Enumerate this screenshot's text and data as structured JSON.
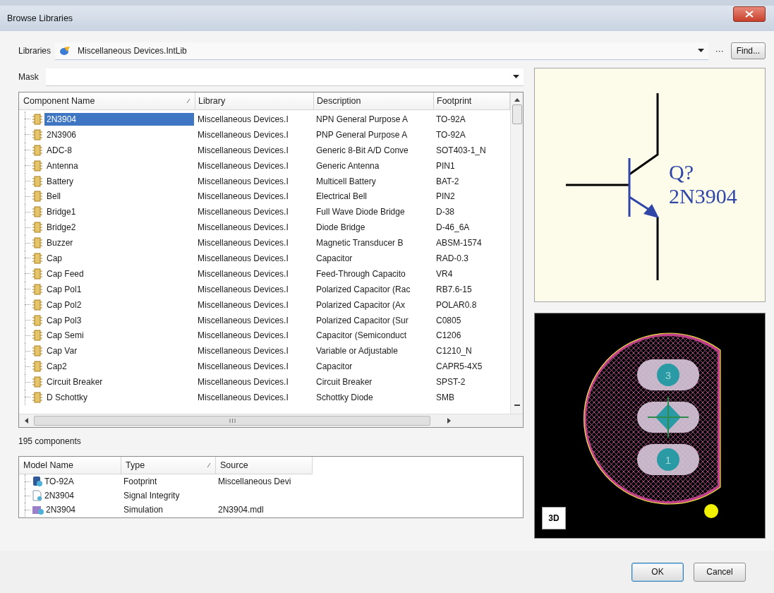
{
  "window": {
    "title": "Browse Libraries"
  },
  "libraries": {
    "label": "Libraries",
    "value": "Miscellaneous Devices.IntLib",
    "more_button": "···",
    "find_button": "Find..."
  },
  "mask": {
    "label": "Mask"
  },
  "components_table": {
    "columns": [
      {
        "label": "Component Name",
        "sorted": true
      },
      {
        "label": "Library",
        "sorted": false
      },
      {
        "label": "Description",
        "sorted": false
      },
      {
        "label": "Footprint",
        "sorted": false
      }
    ],
    "rows": [
      {
        "name": "2N3904",
        "library": "Miscellaneous Devices.I",
        "description": "NPN General Purpose A",
        "footprint": "TO-92A",
        "selected": true
      },
      {
        "name": "2N3906",
        "library": "Miscellaneous Devices.I",
        "description": "PNP General Purpose A",
        "footprint": "TO-92A",
        "selected": false
      },
      {
        "name": "ADC-8",
        "library": "Miscellaneous Devices.I",
        "description": "Generic 8-Bit A/D Conve",
        "footprint": "SOT403-1_N",
        "selected": false
      },
      {
        "name": "Antenna",
        "library": "Miscellaneous Devices.I",
        "description": "Generic Antenna",
        "footprint": "PIN1",
        "selected": false
      },
      {
        "name": "Battery",
        "library": "Miscellaneous Devices.I",
        "description": "Multicell Battery",
        "footprint": "BAT-2",
        "selected": false
      },
      {
        "name": "Bell",
        "library": "Miscellaneous Devices.I",
        "description": "Electrical Bell",
        "footprint": "PIN2",
        "selected": false
      },
      {
        "name": "Bridge1",
        "library": "Miscellaneous Devices.I",
        "description": "Full Wave Diode Bridge",
        "footprint": "D-38",
        "selected": false
      },
      {
        "name": "Bridge2",
        "library": "Miscellaneous Devices.I",
        "description": "Diode Bridge",
        "footprint": "D-46_6A",
        "selected": false
      },
      {
        "name": "Buzzer",
        "library": "Miscellaneous Devices.I",
        "description": "Magnetic Transducer B",
        "footprint": "ABSM-1574",
        "selected": false
      },
      {
        "name": "Cap",
        "library": "Miscellaneous Devices.I",
        "description": "Capacitor",
        "footprint": "RAD-0.3",
        "selected": false
      },
      {
        "name": "Cap Feed",
        "library": "Miscellaneous Devices.I",
        "description": "Feed-Through Capacito",
        "footprint": "VR4",
        "selected": false
      },
      {
        "name": "Cap Pol1",
        "library": "Miscellaneous Devices.I",
        "description": "Polarized Capacitor (Rac",
        "footprint": "RB7.6-15",
        "selected": false
      },
      {
        "name": "Cap Pol2",
        "library": "Miscellaneous Devices.I",
        "description": "Polarized Capacitor (Ax",
        "footprint": "POLAR0.8",
        "selected": false
      },
      {
        "name": "Cap Pol3",
        "library": "Miscellaneous Devices.I",
        "description": "Polarized Capacitor (Sur",
        "footprint": "C0805",
        "selected": false
      },
      {
        "name": "Cap Semi",
        "library": "Miscellaneous Devices.I",
        "description": "Capacitor (Semiconduct",
        "footprint": "C1206",
        "selected": false
      },
      {
        "name": "Cap Var",
        "library": "Miscellaneous Devices.I",
        "description": "Variable or Adjustable",
        "footprint": "C1210_N",
        "selected": false
      },
      {
        "name": "Cap2",
        "library": "Miscellaneous Devices.I",
        "description": "Capacitor",
        "footprint": "CAPR5-4X5",
        "selected": false
      },
      {
        "name": "Circuit Breaker",
        "library": "Miscellaneous Devices.I",
        "description": "Circuit Breaker",
        "footprint": "SPST-2",
        "selected": false
      },
      {
        "name": "D Schottky",
        "library": "Miscellaneous Devices.I",
        "description": "Schottky Diode",
        "footprint": "SMB",
        "selected": false
      }
    ]
  },
  "component_count": "195 components",
  "models_table": {
    "columns": [
      {
        "label": "Model Name",
        "sorted": false
      },
      {
        "label": "Type",
        "sorted": true
      },
      {
        "label": "Source",
        "sorted": false
      }
    ],
    "rows": [
      {
        "kind": "footprint",
        "name": "TO-92A",
        "type": "Footprint",
        "source": "Miscellaneous Devi"
      },
      {
        "kind": "signal-integrity",
        "name": "2N3904",
        "type": "Signal Integrity"
      },
      {
        "kind": "simulation",
        "name": "2N3904",
        "type": "Simulation",
        "source": "2N3904.mdl"
      }
    ]
  },
  "schematic_preview": {
    "designator": "Q?",
    "comment": "2N3904"
  },
  "footprint_preview": {
    "pads": [
      {
        "kind": "numbered",
        "label": "3"
      },
      {
        "kind": "origin"
      },
      {
        "kind": "numbered",
        "label": "1"
      }
    ],
    "view_button": "3D"
  },
  "buttons": [
    {
      "label": "OK",
      "default": true
    },
    {
      "label": "Cancel",
      "default": false
    }
  ]
}
